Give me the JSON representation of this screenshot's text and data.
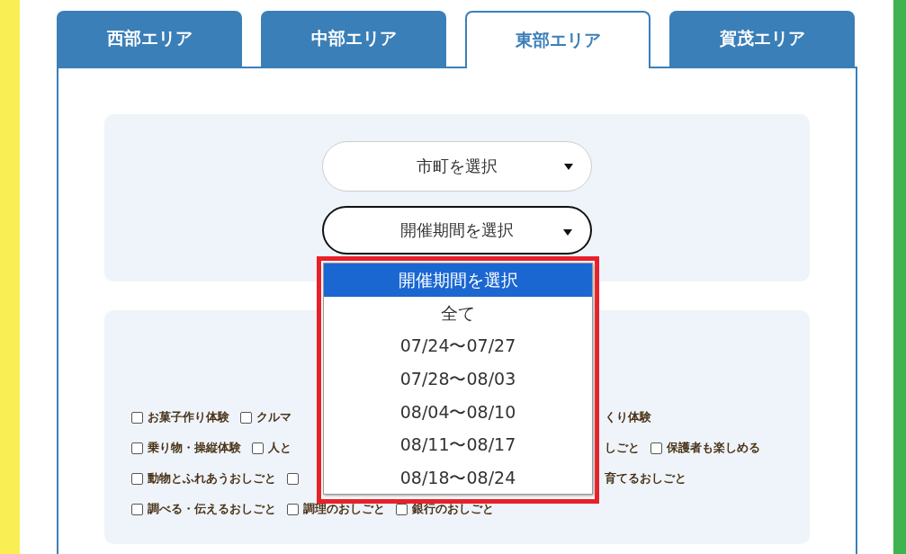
{
  "tabs": [
    {
      "label": "西部エリア",
      "selected": false
    },
    {
      "label": "中部エリア",
      "selected": false
    },
    {
      "label": "東部エリア",
      "selected": true
    },
    {
      "label": "賀茂エリア",
      "selected": false
    }
  ],
  "filters": {
    "city_select": {
      "value": "市町を選択",
      "focused": false
    },
    "period_select": {
      "value": "開催期間を選択",
      "focused": true,
      "expanded": true,
      "options": [
        {
          "label": "開催期間を選択",
          "selected": true
        },
        {
          "label": "全て",
          "selected": false
        },
        {
          "label": "07/24〜07/27",
          "selected": false
        },
        {
          "label": "07/28〜08/03",
          "selected": false
        },
        {
          "label": "08/04〜08/10",
          "selected": false
        },
        {
          "label": "08/11〜08/17",
          "selected": false
        },
        {
          "label": "08/18〜08/24",
          "selected": false
        }
      ]
    }
  },
  "categories": [
    {
      "left": [
        {
          "kind": "checkbox",
          "label": "お菓子作り体験",
          "checked": false
        },
        {
          "kind": "checkbox",
          "label": "クルマ",
          "checked": false
        }
      ],
      "right": [
        {
          "kind": "fragment",
          "label": "くり体験"
        }
      ]
    },
    {
      "left": [
        {
          "kind": "checkbox",
          "label": "乗り物・操縦体験",
          "checked": false
        },
        {
          "kind": "checkbox",
          "label": "人と",
          "checked": false
        }
      ],
      "right": [
        {
          "kind": "fragment",
          "label": "しごと"
        },
        {
          "kind": "checkbox",
          "label": "保護者も楽しめる",
          "checked": false
        }
      ]
    },
    {
      "left": [
        {
          "kind": "checkbox",
          "label": "動物とふれあうおしごと",
          "checked": false
        },
        {
          "kind": "checkbox",
          "checked": false
        }
      ],
      "right": [
        {
          "kind": "fragment",
          "label": "育てるおしごと"
        }
      ]
    },
    {
      "left": [
        {
          "kind": "checkbox",
          "label": "調べる・伝えるおしごと",
          "checked": false
        },
        {
          "kind": "checkbox",
          "label": "調理のおしごと",
          "checked": false
        },
        {
          "kind": "checkbox",
          "label": "銀行のおしごと",
          "checked": false
        }
      ]
    }
  ]
}
